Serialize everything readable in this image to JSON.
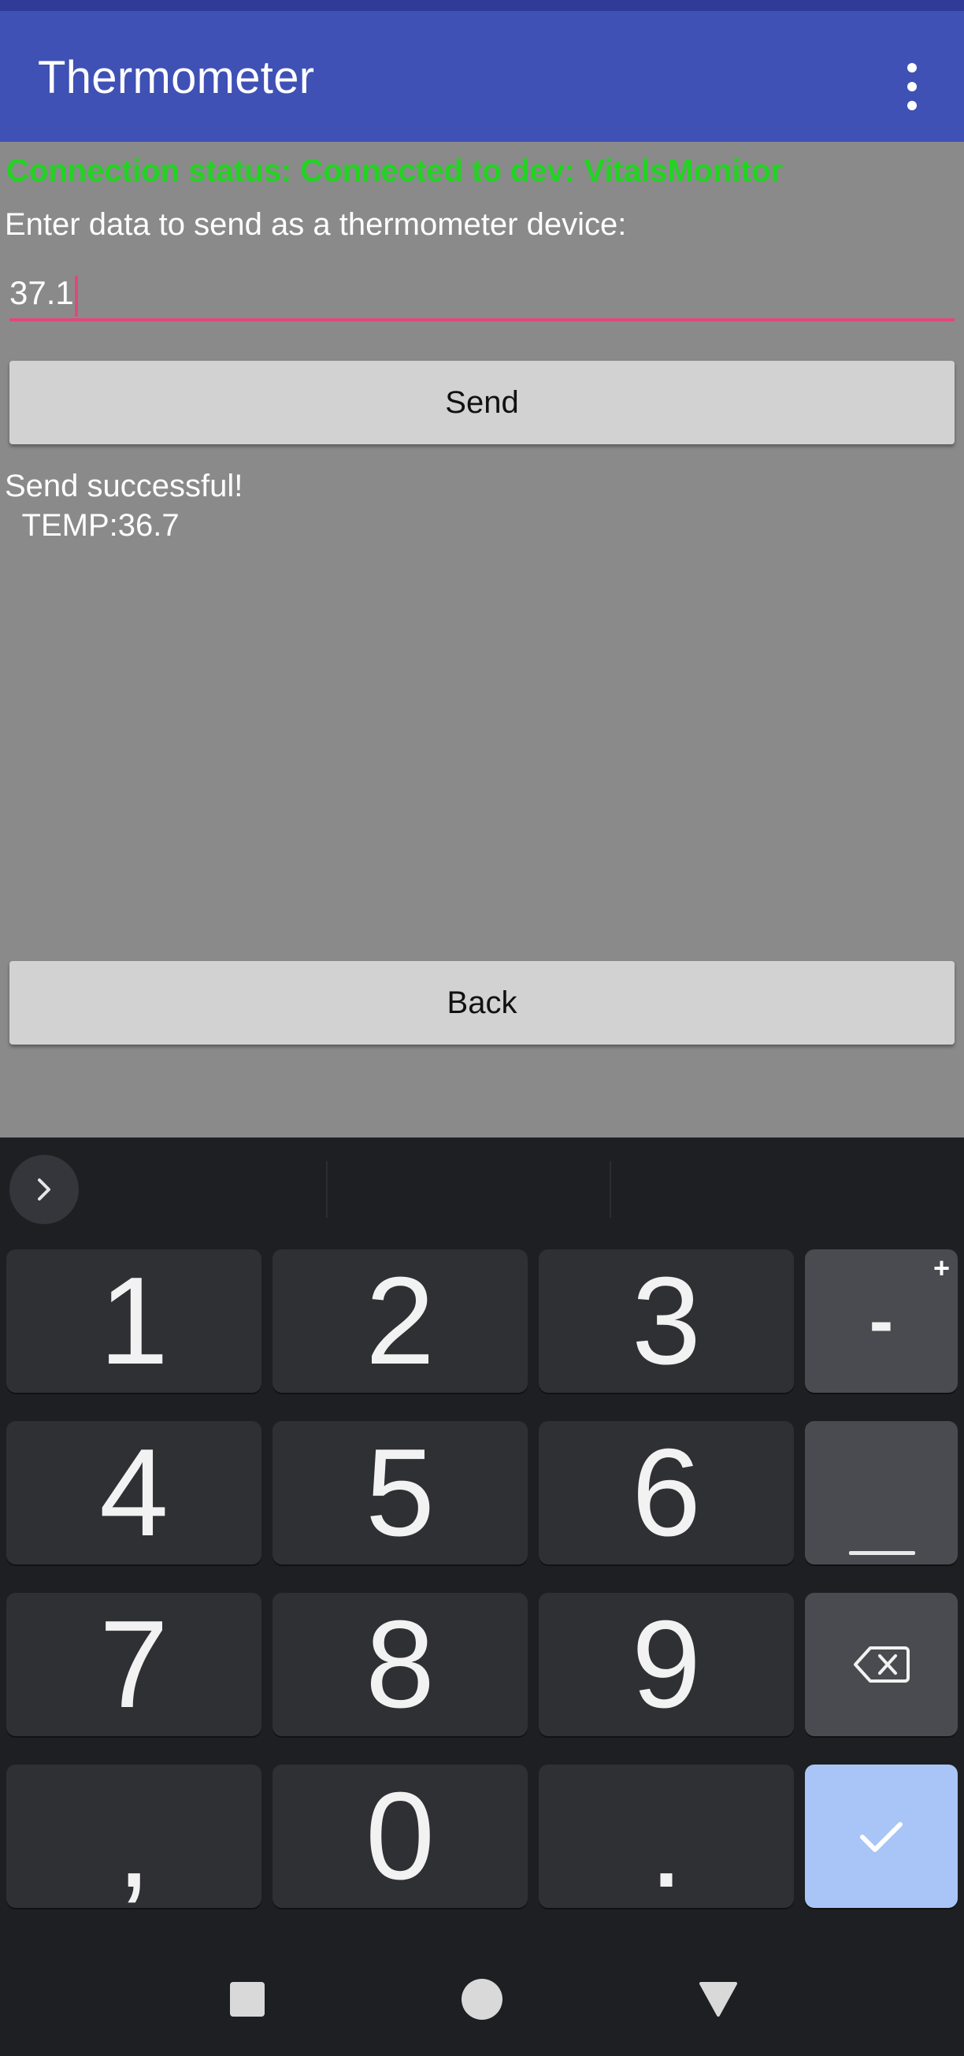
{
  "app_bar": {
    "title": "Thermometer",
    "overflow_icon": "more-vert-icon",
    "color": "#3f51b5",
    "status_strip_color": "#2f3b97"
  },
  "content": {
    "connection_status": "Connection status: Connected to dev: VitalsMonitor",
    "connection_status_color": "#22d322",
    "prompt": "Enter data to send as a thermometer device:",
    "input_value": "37.1",
    "input_accent_color": "#e2487a",
    "send_label": "Send",
    "result_text": "Send successful!\n  TEMP:36.7",
    "back_label": "Back",
    "background": "#8a8a8a"
  },
  "keyboard": {
    "expand_icon": "chevron-right-icon",
    "rows": [
      [
        "1",
        "2",
        "3",
        "-"
      ],
      [
        "4",
        "5",
        "6",
        "space"
      ],
      [
        "7",
        "8",
        "9",
        "backspace"
      ],
      [
        ",",
        "0",
        ".",
        "enter"
      ]
    ],
    "minus_key_alt": "+",
    "backspace_icon": "backspace-icon",
    "enter_icon": "checkmark-icon",
    "enter_color": "#a9c5f7"
  },
  "nav_bar": {
    "recents_icon": "square-recents-icon",
    "home_icon": "circle-home-icon",
    "back_icon": "triangle-back-icon"
  }
}
